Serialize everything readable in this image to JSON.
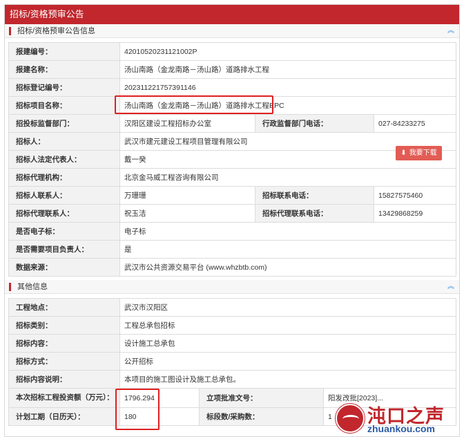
{
  "page_title": "招标/资格预审公告",
  "section1": {
    "title": "招标/资格预审公告信息",
    "rows": {
      "r1": {
        "label": "报建编号：",
        "value": "42010520231121002P"
      },
      "r2": {
        "label": "报建名称：",
        "value": "汤山南路（金龙南路－汤山路）道路排水工程"
      },
      "r3": {
        "label": "招标登记编号：",
        "value": "2023112217573911​46"
      },
      "r4": {
        "label": "招标项目名称：",
        "value": "汤山南路（金龙南路－汤山路）道路排水工程EPC"
      },
      "r5": {
        "label": "招投标监督部门：",
        "value": "汉阳区建设工程招标办公室",
        "label2": "行政监督部门电话：",
        "value2": "027-84233275"
      },
      "r6": {
        "label": "招标人：",
        "value": "武汉市建元建设工程项目管理有限公司"
      },
      "r7": {
        "label": "招标人法定代表人：",
        "value": "戴一癸"
      },
      "r8": {
        "label": "招标代理机构：",
        "value": "北京金马威工程咨询有限公司"
      },
      "r9": {
        "label": "招标人联系人：",
        "value": "万珊珊",
        "label2": "招标联系电话：",
        "value2": "15827575460"
      },
      "r10": {
        "label": "招标代理联系人：",
        "value": "祝玉洁",
        "label2": "招标代理联系电话：",
        "value2": "13429868259"
      },
      "r11": {
        "label": "是否电子标：",
        "value": "电子标"
      },
      "r12": {
        "label": "是否需要项目负责人：",
        "value": "是"
      },
      "r13": {
        "label": "数据来源：",
        "value": "武汉市公共资源交易平台 (www.whzbtb.com)"
      }
    }
  },
  "section2": {
    "title": "其他信息",
    "rows": {
      "r1": {
        "label": "工程地点：",
        "value": "武汉市汉阳区"
      },
      "r2": {
        "label": "招标类别：",
        "value": "工程总承包招标"
      },
      "r3": {
        "label": "招标内容：",
        "value": "设计施工总承包"
      },
      "r4": {
        "label": "招标方式：",
        "value": "公开招标"
      },
      "r5": {
        "label": "招标内容说明：",
        "value": "本项目的施工图设计及施工总承包。"
      },
      "r6": {
        "label": "本次招标工程投资额（万元）：",
        "value": "1796.294",
        "label2": "立项批准文号：",
        "value2": "阳发改批[2023]..."
      },
      "r7": {
        "label": "计划工期（日历天）：",
        "value": "180",
        "label2": "标段数/采购数：",
        "value2": "1"
      }
    }
  },
  "download": {
    "label": "我要下载",
    "icon": "download-icon"
  },
  "watermark": {
    "name": "沌口之声",
    "url": "zhuankou.com"
  },
  "colors": {
    "brand_red": "#c1272d",
    "highlight_red": "#e02020",
    "button_red": "#e25c55",
    "label_bg": "#f2f2f2"
  }
}
